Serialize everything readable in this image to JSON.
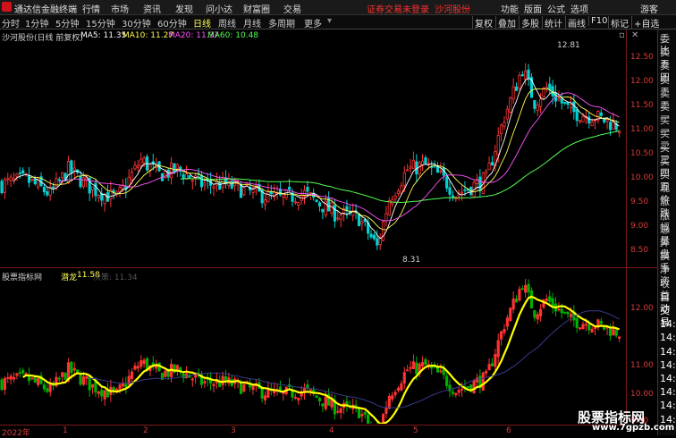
{
  "app": {
    "title": "通达信金融终端"
  },
  "menu": [
    "行情",
    "市场",
    "资讯",
    "发现",
    "问小达",
    "财富圈",
    "交易"
  ],
  "warning": "证券交易未登录",
  "stock_name_top": "沙河股份",
  "right_menu": [
    "功能",
    "版面",
    "公式",
    "选项"
  ],
  "guest": "游客",
  "periods": [
    "分时",
    "1分钟",
    "5分钟",
    "15分钟",
    "30分钟",
    "60分钟",
    "日线",
    "周线",
    "月线",
    "多周期",
    "更多"
  ],
  "active_period": "日线",
  "toolbar_buttons": [
    "复权",
    "叠加",
    "多股",
    "统计",
    "画线",
    "F10",
    "标记",
    "+自选"
  ],
  "chart_title": "沙河股份(日线 前复权)",
  "ma": [
    {
      "label": "MA5: 11.35",
      "color": "#ffffff"
    },
    {
      "label": "MA10: 11.27",
      "color": "#ffff54"
    },
    {
      "label": "MA20: 11.37",
      "color": "#ff54ff"
    },
    {
      "label": "MA60: 10.48",
      "color": "#54ff54"
    }
  ],
  "main_yaxis": [
    "12.50",
    "12.00",
    "11.50",
    "11.00",
    "10.50",
    "10.00",
    "9.50",
    "9.00",
    "8.50"
  ],
  "high_label": "12.81",
  "low_label": "8.31",
  "indicator_title": "股票指标网",
  "indicator_series": {
    "name": "潜龙",
    "value": "11.58"
  },
  "indicator_series2": "决策: 11.34",
  "sub_yaxis": [
    "12.00",
    "11.00",
    "10.00",
    "9.00"
  ],
  "x_labels": [
    "2022年",
    "1",
    "2",
    "3",
    "4",
    "5",
    "6"
  ],
  "sidebar": [
    "委比",
    "卖五",
    "卖四",
    "卖三",
    "卖二",
    "卖一",
    "买一",
    "买二",
    "买三",
    "买四",
    "买五",
    "现价",
    "涨跌",
    "涨幅",
    "总量",
    "外盘",
    "换手",
    "净资",
    "收益",
    "自动",
    "交易",
    "14:50",
    "14:50",
    "14:50",
    "14:50",
    "14:50",
    "14:50",
    "14:50",
    "14:50"
  ],
  "watermark": "股票指标网",
  "watermark_url": "www.7gpzb.com",
  "colors": {
    "up": "#ff3333",
    "down": "#00d2d2",
    "yellow": "#ffff00"
  }
}
